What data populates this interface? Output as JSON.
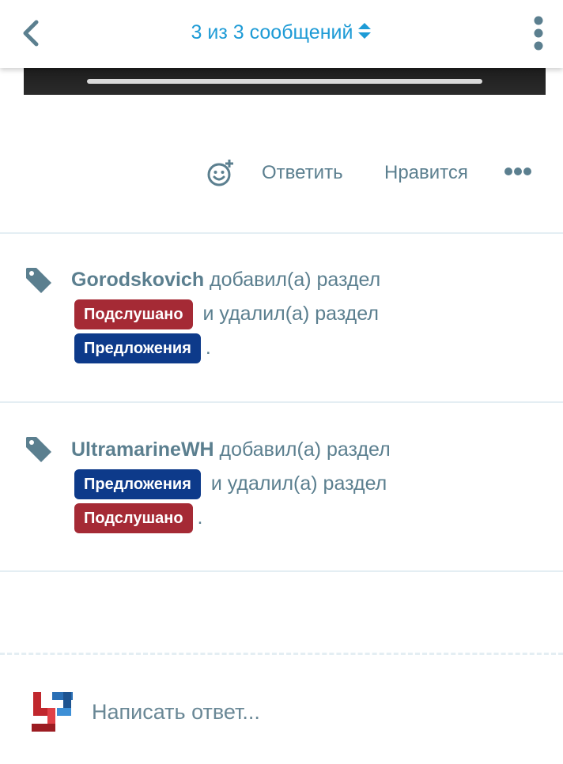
{
  "header": {
    "title": "3 из 3 сообщений"
  },
  "actions": {
    "reply_label": "Ответить",
    "like_label": "Нравится"
  },
  "events": [
    {
      "user": "Gorodskovich",
      "added_text": "добавил(а) раздел",
      "added_section": "Подслушано",
      "removed_text": "и удалил(а) раздел",
      "removed_section": "Предложения",
      "end": "."
    },
    {
      "user": "UltramarineWH",
      "added_text": "добавил(а) раздел",
      "added_section": "Предложения",
      "removed_text": "и удалил(а) раздел",
      "removed_section": "Подслушано",
      "end": "."
    }
  ],
  "composer": {
    "placeholder": "Написать ответ..."
  },
  "colors": {
    "accent": "#1e9bd6",
    "text_muted": "#5b7f8f",
    "badge_podslushano": "#a52a35",
    "badge_predlozheniya": "#0d3a8a"
  },
  "icons": {
    "back": "chevron-left-icon",
    "sort": "sort-arrows-icon",
    "menu": "vertical-dots-icon",
    "react": "add-reaction-icon",
    "more": "horizontal-dots-icon",
    "tag": "tag-icon"
  }
}
